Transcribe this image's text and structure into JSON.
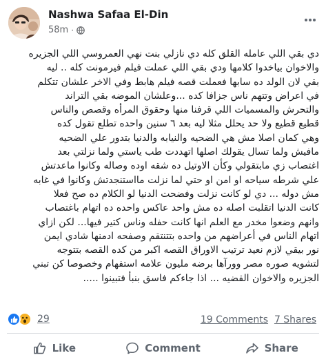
{
  "post": {
    "author": "Nashwa Safaa El-Din",
    "time": "58m",
    "separator": "·",
    "privacy_icon": "globe-icon",
    "more_icon": "more-options-icon",
    "lines": [
      "دي بقي اللي عامله القلق كله دي نازلي بنت نهي العمروسي اللي الجزيره",
      "والاخوان بياخدوا كلامها ودي بقي اللي عملت فيلم فيرمونت كله .. ليه",
      "بقي لان الولد ده سابها فعملت قصه فيلم هابط وفي الاخر علشان تتكلم",
      "في اعراض وتتهم ناس جزافا كده ...وعلشان الموضه بقي التراند",
      "والتحرش والمسميات اللي قرفنا منها وحقوق المرأه وقصص والناس",
      "قطيع قطيع ولا حد يحلل مثلا ليه بعد ٦ سنين واحده تطلع تقول كده",
      "وهي كمان اصلا مش هي الضحيه والنيابه والدنيا بتدور علي الضحيه",
      "مافيش ولما تسال يقولك اصلها اتهددت طب ياستي ولما نزلتي بعد",
      "اغتصاب زي مابتقولي وكأن الاوتيل ده شقه اوده وصاله وكانوا ماعدتش",
      "علي شرطه سياحه او امن او حتي لما نزلت مااستنجدتش وكانوا في غابه",
      "مش دوله ... دي لو كانت نزلت وفضحت الدنيا لو الكلام ده صح فعلا",
      "كانت الدنيا اتقلبت اصله ده مش واحد عاكس واحده ده اتهام باغتصاب",
      "وانهم وضعوا مخدر مع العلم انها كانت حفله وناس كتير فيها... لكن ازاي",
      "اتهام الناس في أعراضهم من واحده بتتنتقم وصفحه ادمنها شادي ايمن",
      "نور بيقي لازم نعيد ترتيب الاوراق القصه اكبر من كده القصه بتتوجه",
      "لتشويه  صوره مصر وورآها برضه مليون علامه استفهام وخصوصا كن تبني",
      "الجزيره والاخوان القضيه ... اذا جاءكم فاسق بنبأ فتبينوا ....."
    ]
  },
  "reactions": {
    "icons": [
      "like-reaction-icon",
      "wow-reaction-icon"
    ],
    "count": "29",
    "comments": "19 Comments",
    "shares": "7 Shares"
  },
  "actions": {
    "like": "Like",
    "comment": "Comment",
    "share": "Share"
  },
  "colors": {
    "accent": "#1877f2",
    "text": "#1c1e21",
    "secondary": "#606770",
    "wow": "#f7b125"
  }
}
